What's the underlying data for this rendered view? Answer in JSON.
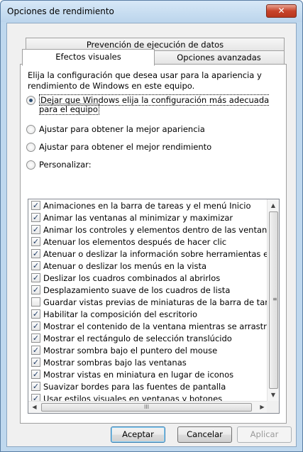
{
  "window": {
    "title": "Opciones de rendimiento",
    "close_label": "✕"
  },
  "tabs": {
    "row1": "Prevención de ejecución de datos",
    "active": "Efectos visuales",
    "advanced": "Opciones avanzadas"
  },
  "description": "Elija la configuración que desea usar para la apariencia y rendimiento de Windows en este equipo.",
  "radios": [
    {
      "label": "Dejar que Windows elija la configuración más adecuada para el equipo",
      "checked": true
    },
    {
      "label": "Ajustar para obtener la mejor apariencia",
      "checked": false
    },
    {
      "label": "Ajustar para obtener el mejor rendimiento",
      "checked": false
    },
    {
      "label": "Personalizar:",
      "checked": false
    }
  ],
  "effects": [
    {
      "label": "Animaciones en la barra de tareas y el menú Inicio",
      "checked": true
    },
    {
      "label": "Animar las ventanas al minimizar y maximizar",
      "checked": true
    },
    {
      "label": "Animar los controles y elementos dentro de las ventanas",
      "checked": true
    },
    {
      "label": "Atenuar los elementos después de hacer clic",
      "checked": true
    },
    {
      "label": "Atenuar o deslizar la información sobre herramientas en la",
      "checked": true
    },
    {
      "label": "Atenuar o deslizar los menús en la vista",
      "checked": true
    },
    {
      "label": "Deslizar los cuadros combinados al abrirlos",
      "checked": true
    },
    {
      "label": "Desplazamiento suave de los cuadros de lista",
      "checked": true
    },
    {
      "label": "Guardar vistas previas de miniaturas de la barra de tareas",
      "checked": false
    },
    {
      "label": "Habilitar la composición del escritorio",
      "checked": true
    },
    {
      "label": "Mostrar el contenido de la ventana mientras se arrastra",
      "checked": true
    },
    {
      "label": "Mostrar el rectángulo de selección translúcido",
      "checked": true
    },
    {
      "label": "Mostrar sombra bajo el puntero del mouse",
      "checked": true
    },
    {
      "label": "Mostrar sombras bajo las ventanas",
      "checked": true
    },
    {
      "label": "Mostrar vistas en miniatura en lugar de iconos",
      "checked": true
    },
    {
      "label": "Suavizar bordes para las fuentes de pantalla",
      "checked": true
    },
    {
      "label": "Usar estilos visuales en ventanas y botones",
      "checked": true
    }
  ],
  "scroll": {
    "up": "▲",
    "down": "▼",
    "left": "◀",
    "right": "▶",
    "vgrip": "≡",
    "hgrip": "III"
  },
  "buttons": {
    "ok": "Aceptar",
    "cancel": "Cancelar",
    "apply": "Aplicar"
  },
  "colors": {
    "title_bar": "#bcd5ec",
    "close_button": "#c7432a",
    "dialog_bg": "#f0f0f0"
  }
}
